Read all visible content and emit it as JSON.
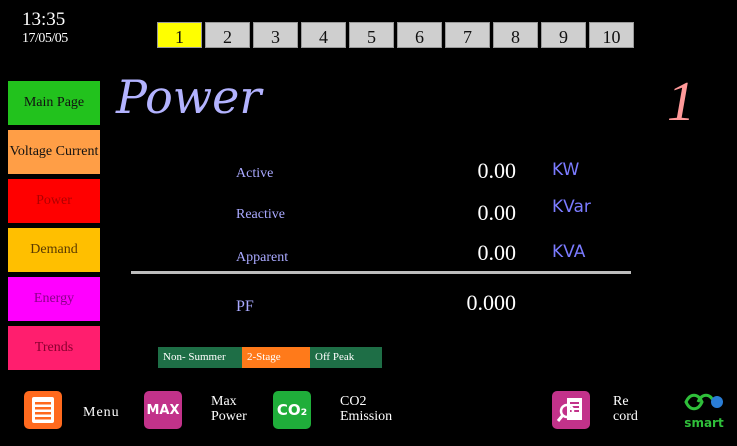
{
  "clock": {
    "time": "13:35",
    "date": "17/05/05"
  },
  "tabs": [
    "1",
    "2",
    "3",
    "4",
    "5",
    "6",
    "7",
    "8",
    "9",
    "10"
  ],
  "active_tab": "1",
  "sidebar": {
    "items": [
      {
        "label": "Main Page",
        "color": "#22c21d",
        "text_color": "#111111"
      },
      {
        "label": "Voltage Current",
        "color": "#ff9e46",
        "text_color": "#111111"
      },
      {
        "label": "Power",
        "color": "#ff0000",
        "text_color": "#b00000"
      },
      {
        "label": "Demand",
        "color": "#ffbf00",
        "text_color": "#5a3a00"
      },
      {
        "label": "Energy",
        "color": "#ff00ff",
        "text_color": "#8a008a"
      },
      {
        "label": "Trends",
        "color": "#ff1e6e",
        "text_color": "#8a0030"
      }
    ]
  },
  "page": {
    "title": "Power",
    "number": "1"
  },
  "readings": [
    {
      "label": "Active",
      "value": "0.00",
      "unit": "KW"
    },
    {
      "label": "Reactive",
      "value": "0.00",
      "unit": "KVar"
    },
    {
      "label": "Apparent",
      "value": "0.00",
      "unit": "KVA"
    }
  ],
  "power_factor": {
    "label": "PF",
    "value": "0.000"
  },
  "tariff": [
    {
      "label": "Non- Summer",
      "color": "#1e6e46"
    },
    {
      "label": "2-Stage",
      "color": "#ff7a1a"
    },
    {
      "label": "Off Peak",
      "color": "#1e6e46"
    }
  ],
  "bottom": {
    "menu": {
      "label": "Menu",
      "icon": "menu-list-icon",
      "color": "#ff6a1e"
    },
    "max": {
      "badge": "MAX",
      "label": "Max\nPower",
      "icon": "max-badge-icon",
      "color": "#c2328a"
    },
    "co2": {
      "badge": "CO₂",
      "label": "CO2\nEmission",
      "icon": "co2-badge-icon",
      "color": "#1fae3a"
    },
    "record": {
      "label": "Re\ncord",
      "icon": "record-search-icon",
      "color": "#c2328a"
    },
    "logo": {
      "text": "smart",
      "icon": "eco-smart-logo"
    }
  }
}
